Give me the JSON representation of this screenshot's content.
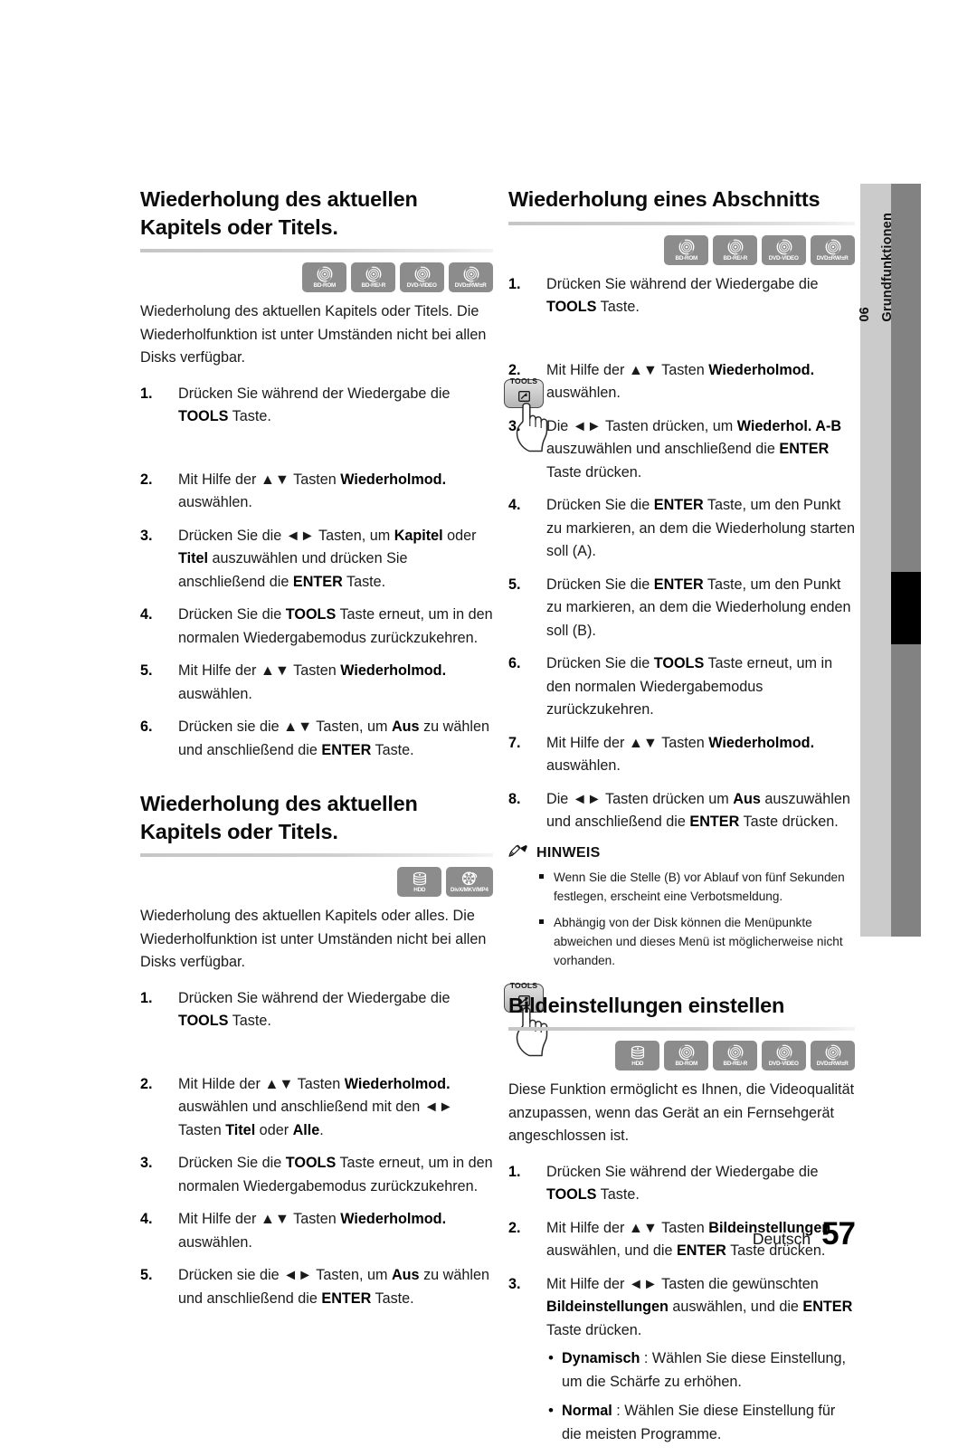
{
  "page": {
    "language_label": "Deutsch",
    "page_number": "57",
    "chapter_number": "06",
    "chapter_title": "Grundfunktionen"
  },
  "icons": {
    "bd_rom": "BD-ROM",
    "bd_re_r": "BD-RE/-R",
    "dvd_video": "DVD-VIDEO",
    "dvd_rw_r": "DVD±RW/±R",
    "hdd": "HDD",
    "divx": "DivX/MKV/MP4",
    "tools_key_label": "TOOLS"
  },
  "left_column": {
    "section1": {
      "heading": "Wiederholung des aktuellen Kapitels oder Titels.",
      "discs": [
        "BD-ROM",
        "BD-RE/-R",
        "DVD-VIDEO",
        "DVD±RW/±R"
      ],
      "intro": "Wiederholung des aktuellen Kapitels oder Titels. Die Wiederholfunktion ist unter Umständen nicht bei allen Disks verfügbar.",
      "steps": [
        {
          "num": "1.",
          "segments": [
            {
              "t": "Drücken Sie während der Wiedergabe die ",
              "b": false
            },
            {
              "t": "TOOLS",
              "b": true
            },
            {
              "t": " Taste.",
              "b": false
            }
          ]
        },
        {
          "num": "2.",
          "segments": [
            {
              "t": "Mit Hilfe der ▲▼ Tasten ",
              "b": false
            },
            {
              "t": "Wiederholmod.",
              "b": true
            },
            {
              "t": " auswählen.",
              "b": false
            }
          ]
        },
        {
          "num": "3.",
          "segments": [
            {
              "t": "Drücken Sie die ◄► Tasten, um ",
              "b": false
            },
            {
              "t": "Kapitel",
              "b": true
            },
            {
              "t": " oder ",
              "b": false
            },
            {
              "t": "Titel",
              "b": true
            },
            {
              "t": " auszuwählen und drücken Sie anschließend die ",
              "b": false
            },
            {
              "t": "ENTER",
              "b": true
            },
            {
              "t": " Taste.",
              "b": false
            }
          ]
        },
        {
          "num": "4.",
          "segments": [
            {
              "t": "Drücken Sie die ",
              "b": false
            },
            {
              "t": "TOOLS",
              "b": true
            },
            {
              "t": " Taste erneut, um in den normalen Wiedergabemodus zurückzukehren.",
              "b": false
            }
          ]
        },
        {
          "num": "5.",
          "segments": [
            {
              "t": "Mit Hilfe der ▲▼ Tasten ",
              "b": false
            },
            {
              "t": "Wiederholmod.",
              "b": true
            },
            {
              "t": " auswählen.",
              "b": false
            }
          ]
        },
        {
          "num": "6.",
          "segments": [
            {
              "t": "Drücken sie die ▲▼ Tasten, um ",
              "b": false
            },
            {
              "t": "Aus",
              "b": true
            },
            {
              "t": " zu wählen und anschließend die ",
              "b": false
            },
            {
              "t": "ENTER",
              "b": true
            },
            {
              "t": " Taste.",
              "b": false
            }
          ]
        }
      ]
    },
    "section2": {
      "heading": "Wiederholung des aktuellen Kapitels oder Titels.",
      "discs": [
        "HDD",
        "DivX/MKV/MP4"
      ],
      "intro": "Wiederholung des aktuellen Kapitels oder alles. Die Wiederholfunktion ist unter Umständen nicht bei allen Disks verfügbar.",
      "steps": [
        {
          "num": "1.",
          "segments": [
            {
              "t": "Drücken Sie während der Wiedergabe die ",
              "b": false
            },
            {
              "t": "TOOLS",
              "b": true
            },
            {
              "t": " Taste.",
              "b": false
            }
          ]
        },
        {
          "num": "2.",
          "segments": [
            {
              "t": "Mit Hilde der ▲▼ Tasten ",
              "b": false
            },
            {
              "t": "Wiederholmod.",
              "b": true
            },
            {
              "t": " auswählen und anschließend mit den ◄► Tasten ",
              "b": false
            },
            {
              "t": "Titel",
              "b": true
            },
            {
              "t": " oder ",
              "b": false
            },
            {
              "t": "Alle",
              "b": true
            },
            {
              "t": ".",
              "b": false
            }
          ]
        },
        {
          "num": "3.",
          "segments": [
            {
              "t": "Drücken Sie die ",
              "b": false
            },
            {
              "t": "TOOLS",
              "b": true
            },
            {
              "t": " Taste erneut, um in den normalen Wiedergabemodus zurückzukehren.",
              "b": false
            }
          ]
        },
        {
          "num": "4.",
          "segments": [
            {
              "t": "Mit Hilfe der ▲▼ Tasten ",
              "b": false
            },
            {
              "t": "Wiederholmod.",
              "b": true
            },
            {
              "t": " auswählen.",
              "b": false
            }
          ]
        },
        {
          "num": "5.",
          "segments": [
            {
              "t": "Drücken sie die ◄► Tasten, um ",
              "b": false
            },
            {
              "t": "Aus",
              "b": true
            },
            {
              "t": " zu wählen und anschließend die ",
              "b": false
            },
            {
              "t": "ENTER",
              "b": true
            },
            {
              "t": " Taste.",
              "b": false
            }
          ]
        }
      ]
    }
  },
  "right_column": {
    "section1": {
      "heading": "Wiederholung eines Abschnitts",
      "discs": [
        "BD-ROM",
        "BD-RE/-R",
        "DVD-VIDEO",
        "DVD±RW/±R"
      ],
      "steps": [
        {
          "num": "1.",
          "segments": [
            {
              "t": "Drücken Sie während der Wiedergabe die ",
              "b": false
            },
            {
              "t": "TOOLS",
              "b": true
            },
            {
              "t": " Taste.",
              "b": false
            }
          ]
        },
        {
          "num": "2.",
          "segments": [
            {
              "t": "Mit Hilfe der ▲▼ Tasten ",
              "b": false
            },
            {
              "t": "Wiederholmod.",
              "b": true
            },
            {
              "t": " auswählen.",
              "b": false
            }
          ]
        },
        {
          "num": "3.",
          "segments": [
            {
              "t": "Die ◄► Tasten drücken, um ",
              "b": false
            },
            {
              "t": "Wiederhol. A-B",
              "b": true
            },
            {
              "t": " auszuwählen und anschließend die ",
              "b": false
            },
            {
              "t": "ENTER",
              "b": true
            },
            {
              "t": " Taste drücken.",
              "b": false
            }
          ]
        },
        {
          "num": "4.",
          "segments": [
            {
              "t": "Drücken Sie die ",
              "b": false
            },
            {
              "t": "ENTER",
              "b": true
            },
            {
              "t": " Taste, um den Punkt zu markieren, an dem die Wiederholung starten soll (A).",
              "b": false
            }
          ]
        },
        {
          "num": "5.",
          "segments": [
            {
              "t": "Drücken Sie die ",
              "b": false
            },
            {
              "t": "ENTER",
              "b": true
            },
            {
              "t": " Taste, um den Punkt zu markieren, an dem die Wiederholung enden soll (B).",
              "b": false
            }
          ]
        },
        {
          "num": "6.",
          "segments": [
            {
              "t": "Drücken Sie die ",
              "b": false
            },
            {
              "t": "TOOLS",
              "b": true
            },
            {
              "t": " Taste erneut, um in den normalen Wiedergabemodus zurückzukehren.",
              "b": false
            }
          ]
        },
        {
          "num": "7.",
          "segments": [
            {
              "t": "Mit Hilfe der ▲▼ Tasten ",
              "b": false
            },
            {
              "t": "Wiederholmod.",
              "b": true
            },
            {
              "t": " auswählen.",
              "b": false
            }
          ]
        },
        {
          "num": "8.",
          "segments": [
            {
              "t": "Die ◄► Tasten drücken um ",
              "b": false
            },
            {
              "t": "Aus",
              "b": true
            },
            {
              "t": " auszuwählen und anschließend die ",
              "b": false
            },
            {
              "t": "ENTER",
              "b": true
            },
            {
              "t": " Taste drücken.",
              "b": false
            }
          ]
        }
      ],
      "note": {
        "title": "HINWEIS",
        "items": [
          "Wenn Sie die Stelle (B) vor Ablauf von fünf Sekunden festlegen, erscheint eine Verbotsmeldung.",
          "Abhängig von der Disk können die Menüpunkte abweichen und dieses Menü ist möglicherweise nicht vorhanden."
        ]
      }
    },
    "section2": {
      "heading": "Bildeinstellungen einstellen",
      "discs": [
        "HDD",
        "BD-ROM",
        "BD-RE/-R",
        "DVD-VIDEO",
        "DVD±RW/±R"
      ],
      "intro": "Diese Funktion ermöglicht es Ihnen, die Videoqualität anzupassen, wenn das Gerät an ein Fernsehgerät angeschlossen ist.",
      "steps": [
        {
          "num": "1.",
          "segments": [
            {
              "t": "Drücken Sie während der Wiedergabe die ",
              "b": false
            },
            {
              "t": "TOOLS",
              "b": true
            },
            {
              "t": " Taste.",
              "b": false
            }
          ]
        },
        {
          "num": "2.",
          "segments": [
            {
              "t": "Mit Hilfe der ▲▼ Tasten ",
              "b": false
            },
            {
              "t": "Bildeinstellungen",
              "b": true
            },
            {
              "t": " auswählen, und die ",
              "b": false
            },
            {
              "t": "ENTER",
              "b": true
            },
            {
              "t": " Taste drücken.",
              "b": false
            }
          ]
        },
        {
          "num": "3.",
          "segments": [
            {
              "t": "Mit Hilfe der ◄► Tasten die gewünschten ",
              "b": false
            },
            {
              "t": "Bildeinstellungen",
              "b": true
            },
            {
              "t": " auswählen, und die ",
              "b": false
            },
            {
              "t": "ENTER",
              "b": true
            },
            {
              "t": " Taste drücken.",
              "b": false
            }
          ],
          "sub": [
            [
              {
                "t": "Dynamisch",
                "b": true
              },
              {
                "t": " : Wählen Sie diese Einstellung, um die Schärfe zu erhöhen.",
                "b": false
              }
            ],
            [
              {
                "t": "Normal",
                "b": true
              },
              {
                "t": " : Wählen Sie diese Einstellung für die meisten Programme.",
                "b": false
              }
            ]
          ]
        }
      ]
    }
  }
}
